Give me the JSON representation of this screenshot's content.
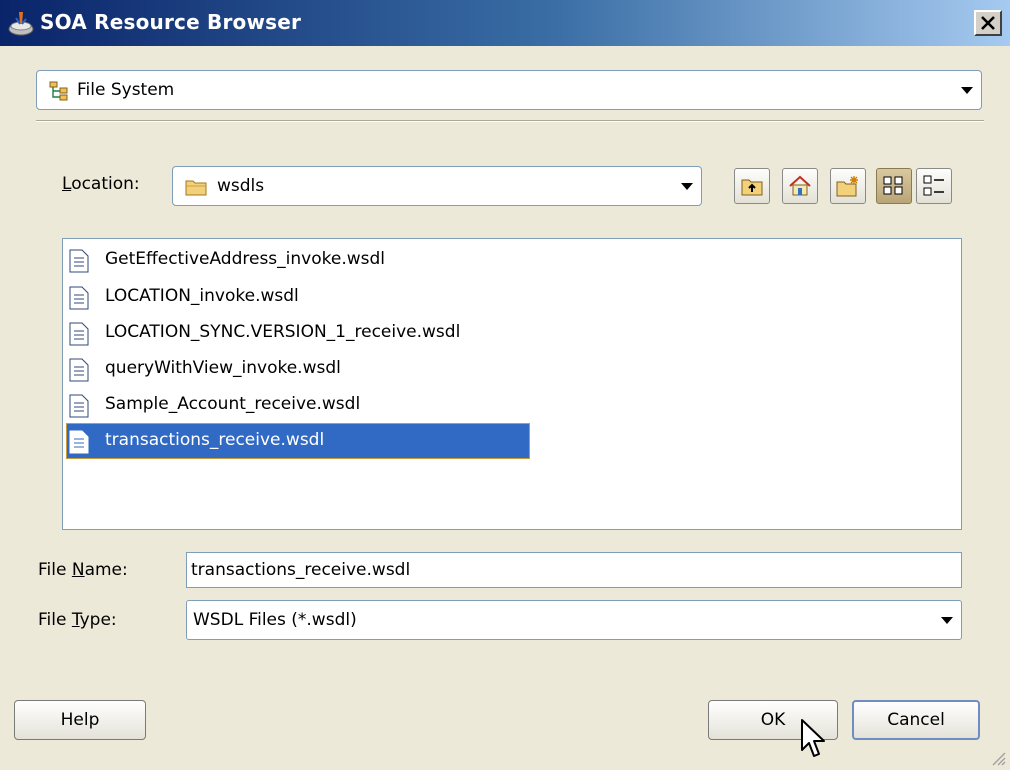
{
  "window": {
    "title": "SOA Resource Browser",
    "close_label": "×"
  },
  "source": {
    "selected": "File System"
  },
  "location": {
    "label_prefix": "",
    "label_underlined": "L",
    "label_rest": "ocation:",
    "selected": "wsdls",
    "toolbar": [
      {
        "name": "up-one-level",
        "icon": "folder-up-icon"
      },
      {
        "name": "home",
        "icon": "home-icon"
      },
      {
        "name": "new-folder",
        "icon": "new-folder-icon"
      },
      {
        "name": "list-view",
        "icon": "list-view-icon",
        "active": true
      },
      {
        "name": "details-view",
        "icon": "details-view-icon"
      }
    ]
  },
  "files": [
    {
      "name": "GetEffectiveAddress_invoke.wsdl"
    },
    {
      "name": "LOCATION_invoke.wsdl"
    },
    {
      "name": "LOCATION_SYNC.VERSION_1_receive.wsdl"
    },
    {
      "name": "queryWithView_invoke.wsdl"
    },
    {
      "name": "Sample_Account_receive.wsdl"
    },
    {
      "name": "transactions_receive.wsdl",
      "selected": true
    }
  ],
  "file_name": {
    "label_prefix": "File ",
    "label_underlined": "N",
    "label_rest": "ame:",
    "value": "transactions_receive.wsdl"
  },
  "file_type": {
    "label_prefix": "File ",
    "label_underlined": "T",
    "label_rest": "ype:",
    "selected": "WSDL Files (*.wsdl)"
  },
  "buttons": {
    "help": "Help",
    "ok": "OK",
    "cancel": "Cancel"
  },
  "colors": {
    "title_gradient_start": "#0a246a",
    "selection": "#316ac5",
    "dialog_bg": "#ece9d8"
  }
}
